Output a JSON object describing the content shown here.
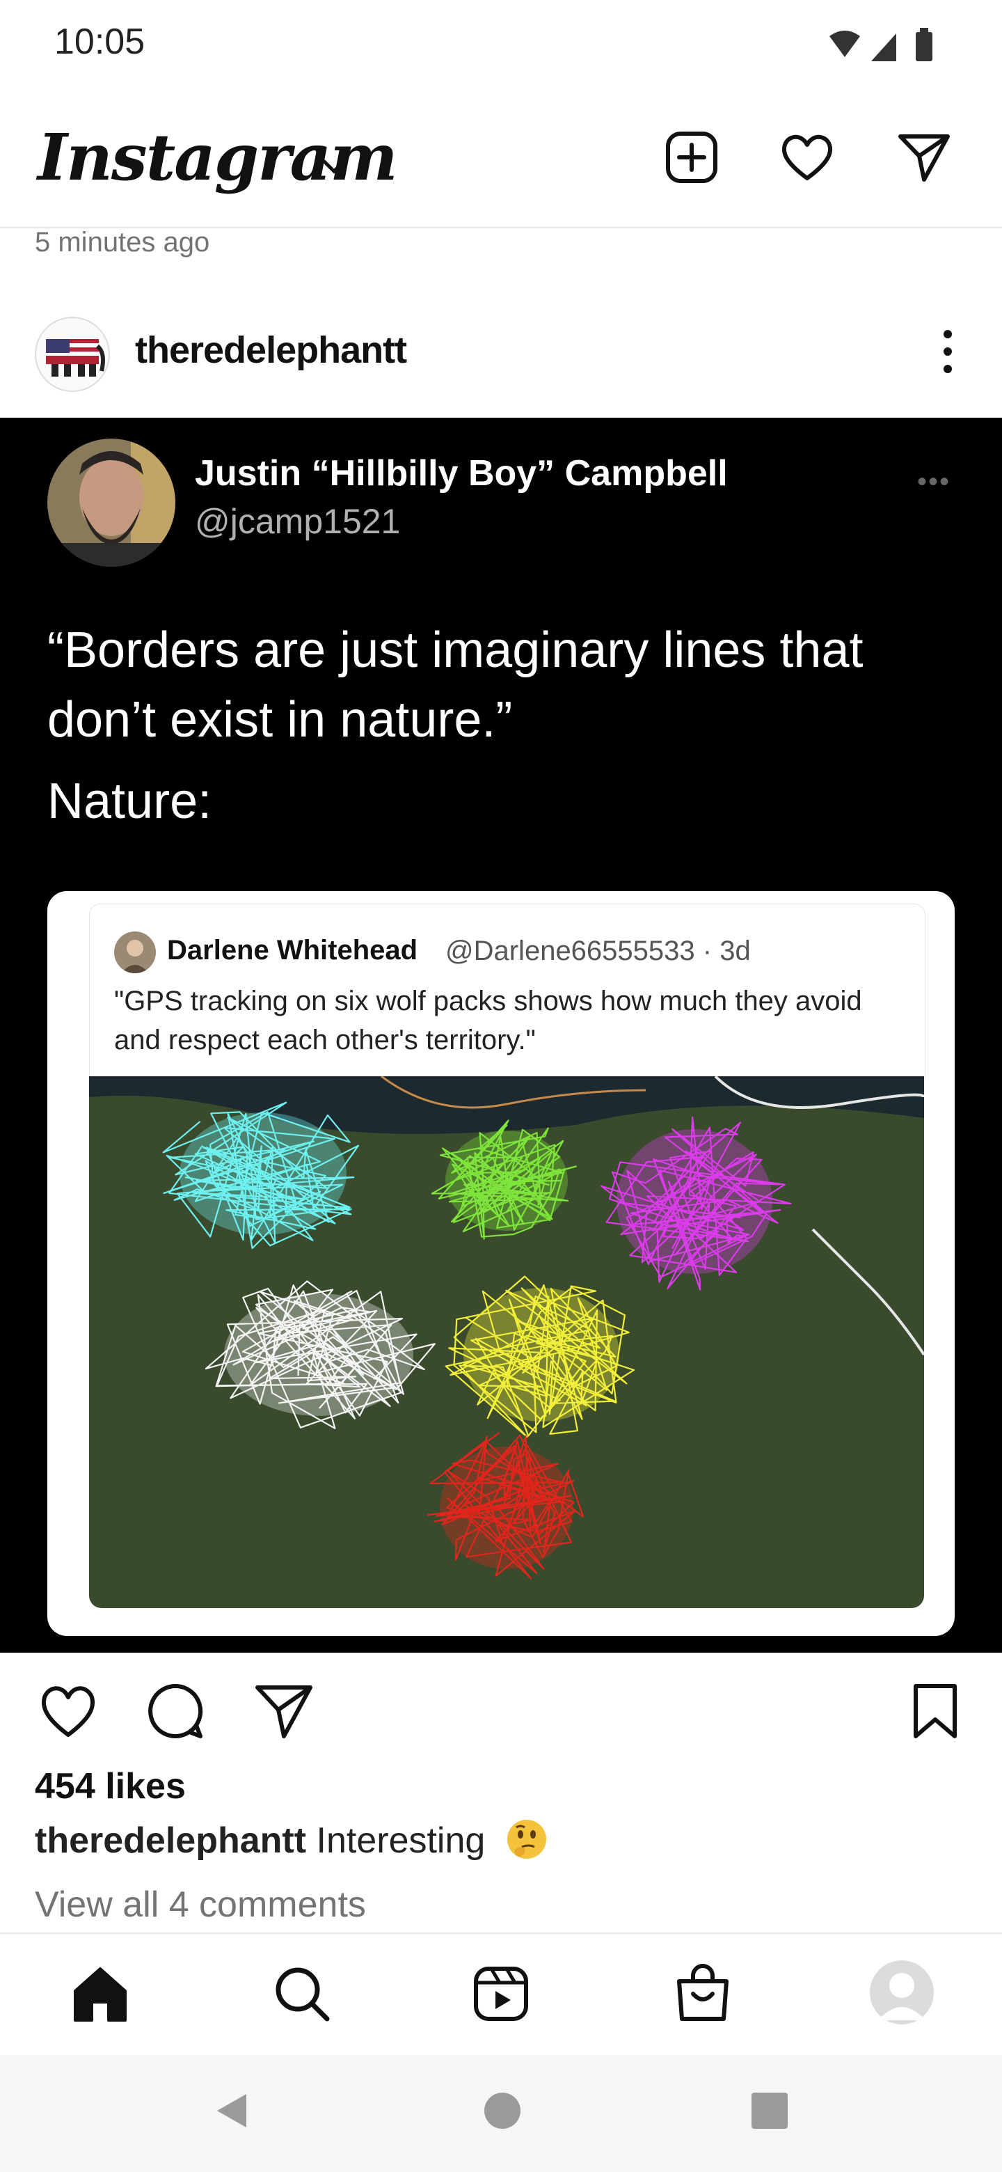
{
  "status_bar": {
    "time": "10:05"
  },
  "app": {
    "logo": "Instagram"
  },
  "post": {
    "time_ago": "5 minutes ago",
    "author": "theredelephantt",
    "likes": "454 likes",
    "caption_author": "theredelephantt",
    "caption_text": "Interesting",
    "view_comments": "View all 4 comments"
  },
  "tweet": {
    "name": "Justin “Hillbilly Boy” Campbell",
    "handle": "@jcamp1521",
    "text": "“Borders are just imaginary lines that don’t exist in nature.”",
    "nature": "Nature:",
    "quote": {
      "name": "Darlene Whitehead",
      "meta": "@Darlene66555533 · 3d",
      "text": "\"GPS tracking on six wolf packs shows how much they avoid and respect each other's territory.\""
    }
  },
  "map_colors": {
    "background": "#3a4a2c",
    "pack_cyan": "#6ef0f0",
    "pack_green": "#7ee33a",
    "pack_magenta": "#d93ce8",
    "pack_white": "#f4f4f4",
    "pack_yellow": "#f2ef3a",
    "pack_red": "#e0261c"
  },
  "icons": {
    "header": [
      "add-post-icon",
      "heart-icon",
      "send-icon"
    ],
    "actions": [
      "like-icon",
      "comment-icon",
      "share-icon",
      "bookmark-icon"
    ],
    "nav": [
      "home-icon",
      "search-icon",
      "reels-icon",
      "shop-icon",
      "profile-avatar"
    ],
    "system": [
      "back-icon",
      "home-circle-icon",
      "recents-icon"
    ]
  }
}
